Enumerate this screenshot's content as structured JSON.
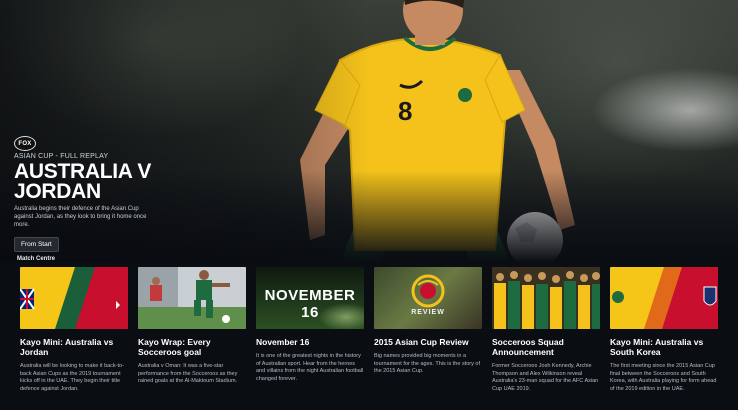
{
  "hero": {
    "brand": "FOX",
    "eyebrow": "ASIAN CUP - FULL REPLAY",
    "title_line1": "AUSTRALIA V",
    "title_line2": "JORDAN",
    "description": "Australia begins their defence of the Asian Cup against Jordan, as they look to bring it home once more.",
    "button_label": "From Start",
    "jersey_number": "8"
  },
  "section_label": "Match Centre",
  "cards": [
    {
      "title": "Kayo Mini: Australia vs Jordan",
      "description": "Australia will be looking to make it back-to-back Asian Cups as the 2019 tournament kicks off in the UAE. They begin their title defence against Jordan."
    },
    {
      "title": "Kayo Wrap: Every Socceroos goal",
      "description": "Australia v Oman: It was a five-star performance from the Socceroos as they rained goals at the Al-Maktoum Stadium."
    },
    {
      "title": "November 16",
      "thumb_text": "NOVEMBER 16",
      "description": "It is one of the greatest nights in the history of Australian sport. Hear from the heroes and villains from the night Australian football changed forever."
    },
    {
      "title": "2015 Asian Cup Review",
      "thumb_text": "REVIEW",
      "description": "Big names provided big moments in a tournament for the ages. This is the story of the 2015 Asian Cup."
    },
    {
      "title": "Socceroos Squad Announcement",
      "description": "Former Socceroos Josh Kennedy, Archie Thompson and Alex Wilkinson reveal Australia's 23-man squad for the AFC Asian Cup UAE 2019."
    },
    {
      "title": "Kayo Mini: Australia vs South Korea",
      "description": "The first meeting since the 2015 Asian Cup final between the Socceroos and South Korea, with Australia playing for form ahead of the 2019 edition in the UAE."
    }
  ],
  "colors": {
    "socceroos_gold": "#f5c518",
    "socceroos_green": "#1b5e3a",
    "jordan_red": "#c8102e"
  }
}
